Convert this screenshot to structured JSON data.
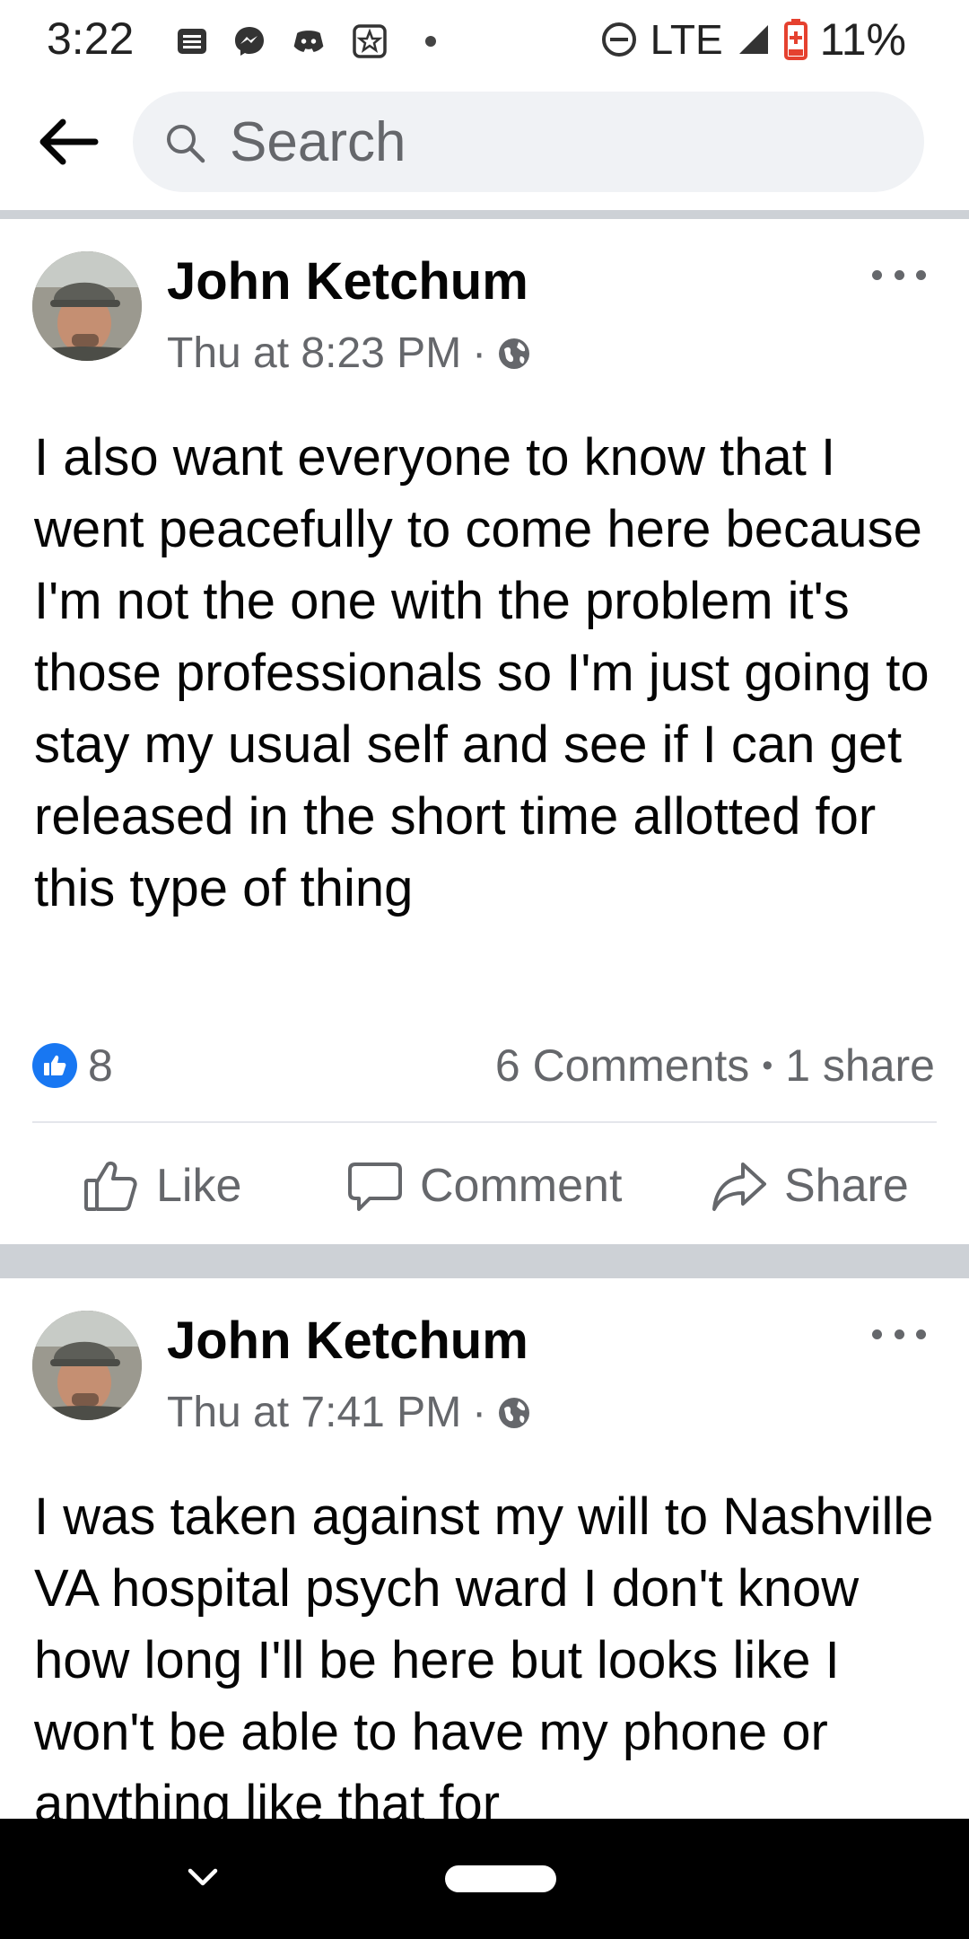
{
  "status_bar": {
    "time": "3:22",
    "network": "LTE",
    "battery": "11%",
    "icons": [
      "news-icon",
      "messenger-icon",
      "discord-icon",
      "star-app-icon",
      "dot-icon",
      "dnd-icon",
      "signal-icon",
      "battery-low-icon"
    ]
  },
  "header": {
    "search_placeholder": "Search"
  },
  "posts": [
    {
      "author": "John Ketchum",
      "time": "Thu at 8:23 PM",
      "separator": "·",
      "body": "I also want everyone to know that I went peacefully to come here because I'm not the one with the problem it's those professionals so I'm just going to stay my usual self and see if I can get released in the short time allotted for this type of thing",
      "reactions": "8",
      "comments": "6 Comments",
      "shares": "1 share",
      "counts_separator": "•",
      "actions": {
        "like": "Like",
        "comment": "Comment",
        "share": "Share"
      }
    },
    {
      "author": "John Ketchum",
      "time": "Thu at 7:41 PM",
      "separator": "·",
      "body": "I was taken against my will to Nashville VA hospital psych ward I don't know how long I'll be here but looks like I won't be able to have my phone or anything like that for"
    }
  ],
  "colors": {
    "accent": "#1877f2",
    "secondary_text": "#65676b",
    "separator": "#cdd1d6"
  }
}
